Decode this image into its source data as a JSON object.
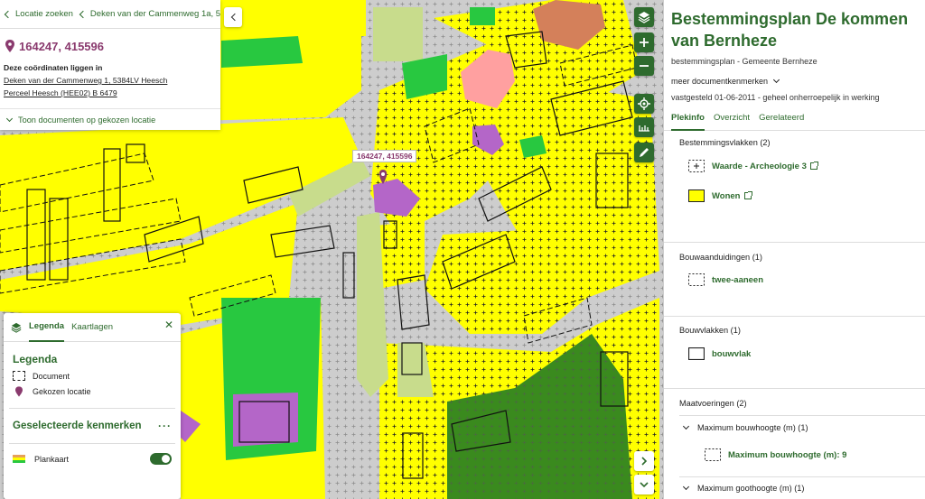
{
  "breadcrumb": {
    "back_label": "Locatie zoeken",
    "address_short": "Deken van der Cammenweg 1a, 5..."
  },
  "location": {
    "coordinates": "164247, 415596",
    "lies_in_label": "Deze coördinaten liggen in",
    "address": "Deken van der Cammenweg 1, 5384LV Heesch",
    "parcel": "Perceel Heesch (HEE02) B 6479",
    "show_docs": "Toon documenten op gekozen locatie"
  },
  "map": {
    "tooltip_coords": "164247, 415596",
    "colors": {
      "wonen": "#ffff00",
      "verkeer": "#cdcdcd",
      "groen": "#28c840",
      "bos": "#3a8a1e",
      "maatschappelijk": "#b466c8",
      "gemengd": "#ffa0a0",
      "cultuur": "#d4805a",
      "tuin": "#c8dc8c"
    }
  },
  "legend": {
    "tabs": [
      "Legenda",
      "Kaartlagen"
    ],
    "active_tab": "Legenda",
    "heading": "Legenda",
    "items": [
      {
        "icon": "document-icon",
        "label": "Document"
      },
      {
        "icon": "location-pin-icon",
        "label": "Gekozen locatie"
      }
    ],
    "selected_heading": "Geselecteerde kenmerken",
    "layer_label": "Plankaart",
    "layer_enabled": true
  },
  "plan": {
    "title": "Bestemmingsplan De kommen van Bernheze",
    "subtitle": "bestemmingsplan - Gemeente Bernheze",
    "more_docs": "meer documentkenmerken",
    "status": "vastgesteld 01-06-2011 - geheel onherroepelijk in werking",
    "tabs": [
      "Plekinfo",
      "Overzicht",
      "Gerelateerd"
    ],
    "active_tab": "Plekinfo",
    "sections": {
      "bestemmingsvlakken": {
        "heading": "Bestemmingsvlakken (2)",
        "items": [
          "Waarde - Archeologie 3",
          "Wonen"
        ]
      },
      "bouwaanduidingen": {
        "heading": "Bouwaanduidingen (1)",
        "items": [
          "twee-aaneen"
        ]
      },
      "bouwvlakken": {
        "heading": "Bouwvlakken (1)",
        "items": [
          "bouwvlak"
        ]
      },
      "maatvoeringen": {
        "heading": "Maatvoeringen (2)",
        "sub1": "Maximum bouwhoogte (m) (1)",
        "sub1_item": "Maximum bouwhoogte (m): 9",
        "sub2": "Maximum goothoogte (m) (1)"
      }
    }
  }
}
